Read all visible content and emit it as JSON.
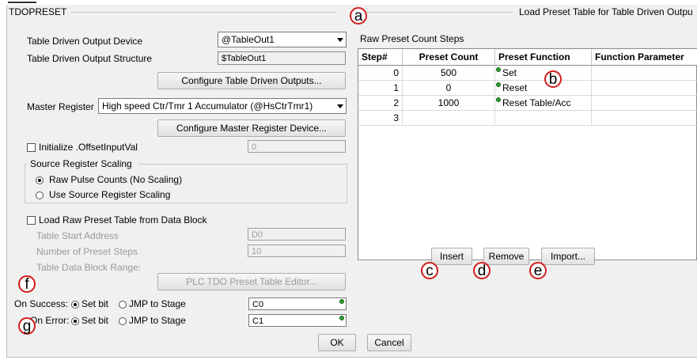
{
  "dialog": {
    "group_title": "TDOPRESET",
    "right_title": "Load Preset Table for Table Driven Outpu"
  },
  "left": {
    "tdo_device_label": "Table Driven Output Device",
    "tdo_device_value": "@TableOut1",
    "tdo_structure_label": "Table Driven Output Structure",
    "tdo_structure_value": "$TableOut1",
    "configure_tdo_button": "Configure Table Driven Outputs...",
    "master_register_label": "Master Register",
    "master_register_value": "High speed Ctr/Tmr 1 Accumulator (@HsCtrTmr1)",
    "configure_master_button": "Configure Master Register Device...",
    "init_offset_label": "Initialize .OffsetInputVal",
    "init_offset_value": "0",
    "source_scaling_title": "Source Register Scaling",
    "raw_pulse_label": "Raw Pulse Counts (No Scaling)",
    "use_source_label": "Use Source Register Scaling",
    "load_raw_label": "Load Raw Preset Table from Data Block",
    "table_start_label": "Table Start Address",
    "table_start_value": "D0",
    "num_steps_label": "Number of Preset Steps",
    "num_steps_value": "10",
    "block_range_label": "Table Data Block Range:",
    "editor_button": "PLC TDO Preset Table Editor...",
    "on_success_label": "On Success:",
    "on_error_label": "On Error:",
    "set_bit_label": "Set bit",
    "jmp_label": "JMP to Stage",
    "success_value": "C0",
    "error_value": "C1"
  },
  "right": {
    "steps_label": "Raw Preset Count Steps",
    "columns": [
      "Step#",
      "Preset Count",
      "Preset Function",
      "Function Parameter"
    ],
    "rows": [
      {
        "step": "0",
        "count": "500",
        "func": "Set",
        "param": ""
      },
      {
        "step": "1",
        "count": "0",
        "func": "Reset",
        "param": ""
      },
      {
        "step": "2",
        "count": "1000",
        "func": "Reset Table/Acc",
        "param": ""
      },
      {
        "step": "3",
        "count": "",
        "func": "",
        "param": ""
      }
    ],
    "insert_button": "Insert",
    "remove_button": "Remove",
    "import_button": "Import..."
  },
  "footer": {
    "ok_button": "OK",
    "cancel_button": "Cancel"
  },
  "callouts": {
    "a": "a",
    "b": "b",
    "c": "c",
    "d": "d",
    "e": "e",
    "f": "f",
    "g": "g"
  }
}
